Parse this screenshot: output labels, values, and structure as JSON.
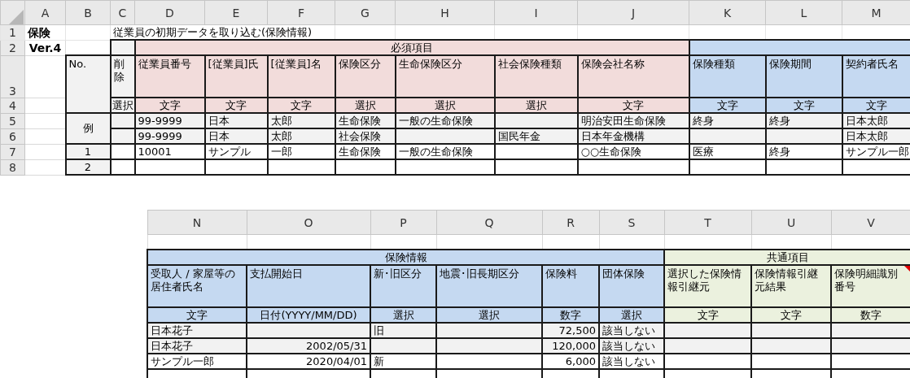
{
  "top_sheet": {
    "columns": [
      "A",
      "B",
      "C",
      "D",
      "E",
      "F",
      "G",
      "H",
      "I",
      "J",
      "K",
      "L",
      "M"
    ],
    "rows": [
      {
        "number": "1",
        "kind": "title",
        "cells": [
          "保険",
          "",
          {
            "text": "従業員の初期データを取り込む(保険情報)",
            "colspan": 4
          },
          "",
          "",
          "",
          "",
          "",
          "",
          ""
        ]
      },
      {
        "number": "2",
        "kind": "section",
        "cells": [
          "Ver.4",
          "",
          "",
          {
            "text": "必須項目",
            "colspan": 7
          },
          {
            "text": "",
            "colspan": 3
          }
        ]
      },
      {
        "number": "3",
        "kind": "header",
        "cells": [
          "",
          {
            "text": "No.",
            "rowspan": 2
          },
          "削除",
          "従業員番号",
          "[従業員]氏",
          "[従業員]名",
          "保険区分",
          "生命保険区分",
          "社会保険種類",
          "保険会社名称",
          "保険種類",
          "保険期間",
          "契約者氏名"
        ]
      },
      {
        "number": "4",
        "kind": "type",
        "cells": [
          "",
          "選択",
          "文字",
          "文字",
          "文字",
          "選択",
          "選択",
          "選択",
          "文字",
          "文字",
          "文字",
          "文字"
        ]
      },
      {
        "number": "5",
        "kind": "data",
        "shaded": true,
        "cells": [
          "",
          {
            "text": "例",
            "rowspan": 2
          },
          "",
          "99-9999",
          "日本",
          "太郎",
          "生命保険",
          "一般の生命保険",
          "",
          "明治安田生命保険",
          "終身",
          "終身",
          "日本太郎"
        ]
      },
      {
        "number": "6",
        "kind": "data",
        "shaded": true,
        "cells": [
          "",
          "",
          "99-9999",
          "日本",
          "太郎",
          "社会保険",
          "",
          "国民年金",
          "日本年金機構",
          "",
          "",
          "日本太郎"
        ]
      },
      {
        "number": "7",
        "kind": "data",
        "shaded": false,
        "cells": [
          "",
          "1",
          "",
          "10001",
          "サンプル",
          "一郎",
          "生命保険",
          "一般の生命保険",
          "",
          "○○生命保険",
          "医療",
          "終身",
          "サンプル一郎"
        ]
      },
      {
        "number": "8",
        "kind": "data",
        "shaded": false,
        "cells": [
          "",
          "2",
          "",
          "",
          "",
          "",
          "",
          "",
          "",
          "",
          "",
          "",
          ""
        ]
      }
    ]
  },
  "bottom_sheet": {
    "columns": [
      "N",
      "O",
      "P",
      "Q",
      "R",
      "S",
      "T",
      "U",
      "V"
    ],
    "rows": [
      {
        "kind": "spacer",
        "cells": [
          "",
          "",
          "",
          "",
          "",
          "",
          "",
          "",
          ""
        ]
      },
      {
        "kind": "section",
        "cells": [
          {
            "text": "保険情報",
            "colspan": 6
          },
          {
            "text": "共通項目",
            "colspan": 3
          }
        ]
      },
      {
        "kind": "header",
        "cells": [
          "受取人 / 家屋等の居住者氏名",
          "支払開始日",
          "新･旧区分",
          "地震･旧長期区分",
          "保険料",
          "団体保険",
          "選択した保険情報引継元",
          "保険情報引継元結果",
          {
            "text": "保険明細識別番号",
            "comment": true
          }
        ]
      },
      {
        "kind": "type",
        "cells": [
          "文字",
          "日付(YYYY/MM/DD)",
          "選択",
          "選択",
          "数字",
          "選択",
          "文字",
          "文字",
          "数字"
        ]
      },
      {
        "kind": "data",
        "shaded": true,
        "cells": [
          "日本花子",
          "",
          "旧",
          "",
          "72,500",
          "該当しない",
          "",
          "",
          ""
        ]
      },
      {
        "kind": "data",
        "shaded": true,
        "cells": [
          "日本花子",
          "2002/05/31",
          "",
          "",
          "120,000",
          "該当しない",
          "",
          "",
          ""
        ]
      },
      {
        "kind": "data",
        "shaded": false,
        "cells": [
          "サンプル一郎",
          "2020/04/01",
          "新",
          "",
          "6,000",
          "該当しない",
          "",
          "",
          ""
        ]
      },
      {
        "kind": "data",
        "shaded": false,
        "cells": [
          "",
          "",
          "",
          "",
          "",
          "",
          "",
          "",
          ""
        ]
      }
    ]
  }
}
